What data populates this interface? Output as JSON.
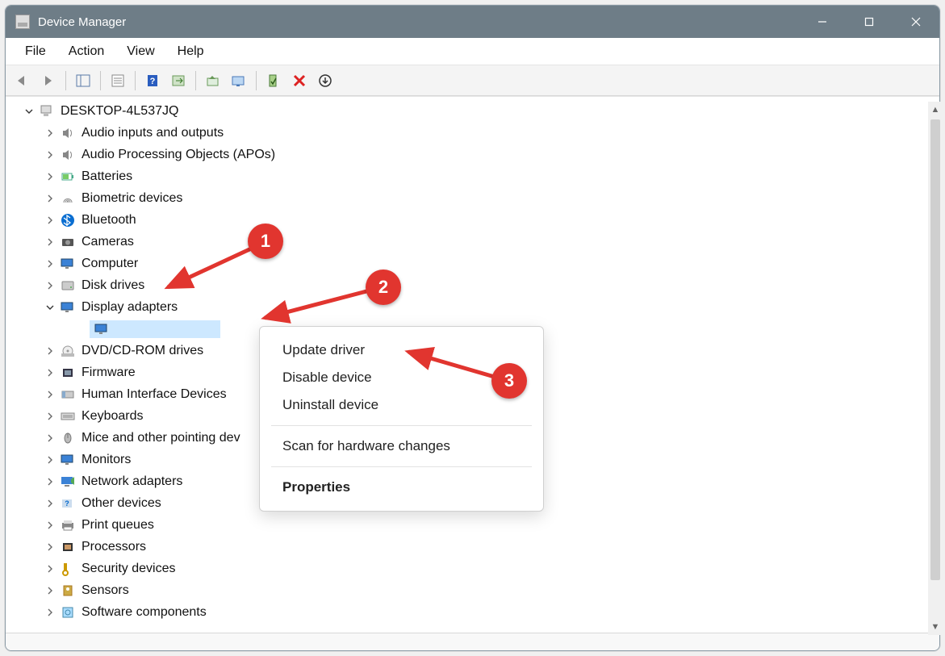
{
  "window": {
    "title": "Device Manager"
  },
  "menus": {
    "file": "File",
    "action": "Action",
    "view": "View",
    "help": "Help"
  },
  "tree": {
    "root": "DESKTOP-4L537JQ",
    "categories": [
      {
        "label": "Audio inputs and outputs",
        "icon": "speaker"
      },
      {
        "label": "Audio Processing Objects (APOs)",
        "icon": "speaker"
      },
      {
        "label": "Batteries",
        "icon": "battery"
      },
      {
        "label": "Biometric devices",
        "icon": "fingerprint"
      },
      {
        "label": "Bluetooth",
        "icon": "bluetooth"
      },
      {
        "label": "Cameras",
        "icon": "camera"
      },
      {
        "label": "Computer",
        "icon": "monitor"
      },
      {
        "label": "Disk drives",
        "icon": "disk"
      },
      {
        "label": "Display adapters",
        "icon": "monitor",
        "expanded": true,
        "children": [
          {
            "label": "",
            "icon": "monitor",
            "selected": true
          }
        ]
      },
      {
        "label": "DVD/CD-ROM drives",
        "icon": "disc"
      },
      {
        "label": "Firmware",
        "icon": "chip"
      },
      {
        "label": "Human Interface Devices",
        "icon": "hid"
      },
      {
        "label": "Keyboards",
        "icon": "keyboard"
      },
      {
        "label": "Mice and other pointing devices",
        "icon": "mouse",
        "truncated": "Mice and other pointing dev"
      },
      {
        "label": "Monitors",
        "icon": "monitor"
      },
      {
        "label": "Network adapters",
        "icon": "network"
      },
      {
        "label": "Other devices",
        "icon": "other"
      },
      {
        "label": "Print queues",
        "icon": "printer"
      },
      {
        "label": "Processors",
        "icon": "cpu"
      },
      {
        "label": "Security devices",
        "icon": "key"
      },
      {
        "label": "Sensors",
        "icon": "sensor"
      },
      {
        "label": "Software components",
        "icon": "software"
      }
    ]
  },
  "contextMenu": {
    "items": [
      {
        "label": "Update driver"
      },
      {
        "label": "Disable device"
      },
      {
        "label": "Uninstall device"
      },
      {
        "sep": true
      },
      {
        "label": "Scan for hardware changes"
      },
      {
        "sep": true
      },
      {
        "label": "Properties",
        "bold": true
      }
    ]
  },
  "annotations": {
    "badge1": "1",
    "badge2": "2",
    "badge3": "3"
  }
}
